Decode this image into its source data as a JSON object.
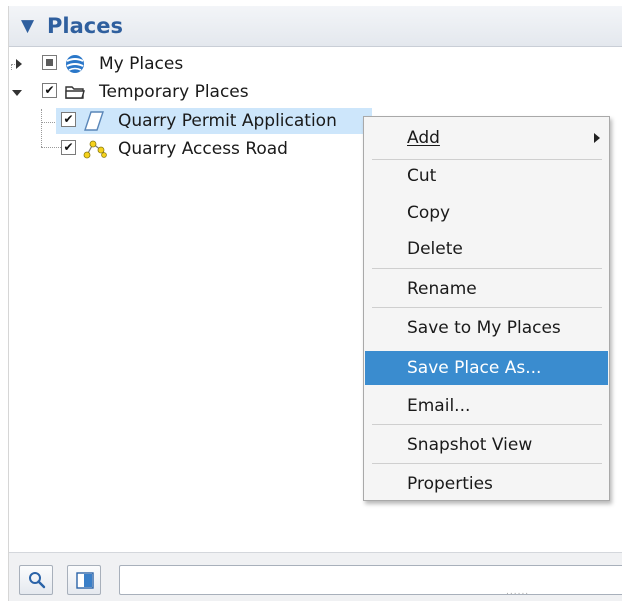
{
  "panel": {
    "title": "Places",
    "collapse_glyph": "▼"
  },
  "tree": {
    "items": [
      {
        "label": "My Places",
        "icon": "globe-icon",
        "checked": "partial",
        "expanded": false
      },
      {
        "label": "Temporary Places",
        "icon": "folder-icon",
        "checked": true,
        "expanded": true
      },
      {
        "label": "Quarry Permit Application",
        "icon": "polygon-icon",
        "checked": true,
        "selected": true
      },
      {
        "label": "Quarry Access Road",
        "icon": "path-icon",
        "checked": true
      }
    ],
    "check_glyph": "✔"
  },
  "context_menu": {
    "items": [
      {
        "label": "Add",
        "submenu": true
      },
      {
        "label": "Cut"
      },
      {
        "label": "Copy"
      },
      {
        "label": "Delete"
      },
      {
        "label": "Rename"
      },
      {
        "label": "Save to My Places"
      },
      {
        "label": "Save Place As...",
        "highlighted": true
      },
      {
        "label": "Email..."
      },
      {
        "label": "Snapshot View"
      },
      {
        "label": "Properties"
      }
    ]
  },
  "bottom_bar": {
    "search_value": "",
    "buttons": [
      "search-icon",
      "panel-toggle-icon"
    ]
  },
  "colors": {
    "header_text": "#2f5f9e",
    "selection": "#cde6fb",
    "menu_highlight": "#3a8ccf",
    "menu_bg": "#f5f5f5"
  }
}
